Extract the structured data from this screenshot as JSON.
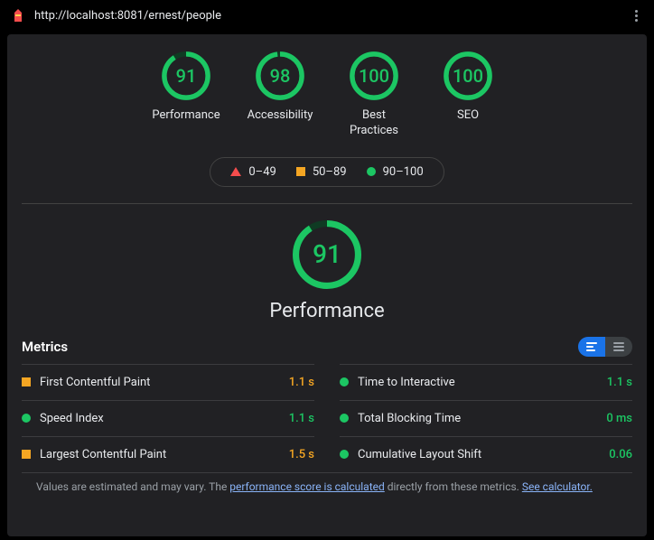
{
  "url": "http://localhost:8081/ernest/people",
  "colors": {
    "pass": "#1cc663",
    "avg": "#f5a623",
    "fail": "#f54d4d",
    "link": "#8ab4f8"
  },
  "gauges": [
    {
      "score": "91",
      "label": "Performance",
      "pct": 91
    },
    {
      "score": "98",
      "label": "Accessibility",
      "pct": 98
    },
    {
      "score": "100",
      "label": "Best Practices",
      "pct": 100
    },
    {
      "score": "100",
      "label": "SEO",
      "pct": 100
    }
  ],
  "legend": {
    "fail": "0–49",
    "avg": "50–89",
    "pass": "90–100"
  },
  "detail": {
    "score": "91",
    "label": "Performance",
    "pct": 91
  },
  "metrics_title": "Metrics",
  "metrics_left": [
    {
      "name": "First Contentful Paint",
      "value": "1.1 s",
      "status": "avg"
    },
    {
      "name": "Speed Index",
      "value": "1.1 s",
      "status": "pass"
    },
    {
      "name": "Largest Contentful Paint",
      "value": "1.5 s",
      "status": "avg"
    }
  ],
  "metrics_right": [
    {
      "name": "Time to Interactive",
      "value": "1.1 s",
      "status": "pass"
    },
    {
      "name": "Total Blocking Time",
      "value": "0 ms",
      "status": "pass"
    },
    {
      "name": "Cumulative Layout Shift",
      "value": "0.06",
      "status": "pass"
    }
  ],
  "footnote": {
    "pre": "Values are estimated and may vary. The ",
    "link1": "performance score is calculated",
    "mid": " directly from these metrics. ",
    "link2": "See calculator."
  }
}
